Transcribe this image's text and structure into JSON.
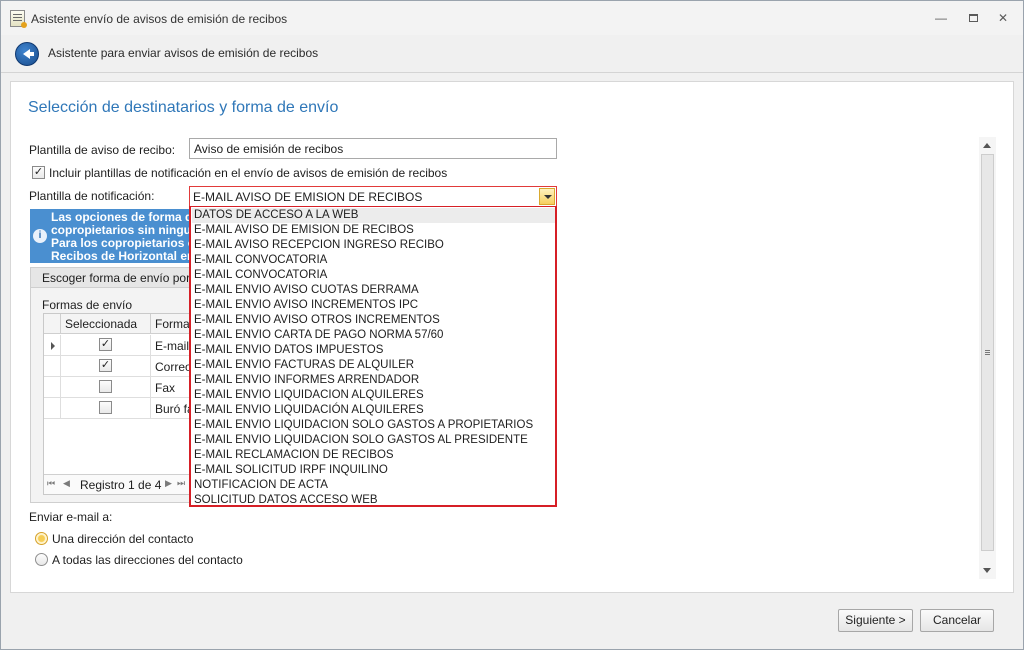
{
  "window": {
    "title": "Asistente envío de avisos de emisión de recibos",
    "minimize_glyph": "—",
    "close_glyph": "✕"
  },
  "header": {
    "title": "Asistente para enviar avisos de emisión de recibos"
  },
  "section": {
    "title": "Selección de destinatarios y forma de envío"
  },
  "form": {
    "plantilla_aviso_label": "Plantilla de aviso de recibo:",
    "plantilla_aviso_value": "Aviso de emisión de recibos",
    "incluir_checkbox_label": "Incluir plantillas de notificación en el envío de avisos de emisión de recibos",
    "incluir_checked": true,
    "plantilla_notificacion_label": "Plantilla de notificación:",
    "plantilla_notificacion_value": "E-MAIL AVISO DE EMISION DE RECIBOS"
  },
  "info": {
    "icon": "i",
    "lines": [
      "Las opciones de forma d",
      "copropietarios sin ningu",
      "Para los copropietarios c",
      "Recibos de Horizontal en"
    ]
  },
  "group": {
    "header": "Escoger forma de envío por de",
    "formas_label": "Formas de envío",
    "columns": [
      "Seleccionada",
      "Forma d"
    ],
    "rows": [
      {
        "selected": true,
        "name": "E-mail"
      },
      {
        "selected": true,
        "name": "Correo"
      },
      {
        "selected": false,
        "name": "Fax"
      },
      {
        "selected": false,
        "name": "Buró fax"
      }
    ],
    "navigator": {
      "first": "⏮",
      "prev": "◀",
      "record_text": "Registro 1 de 4",
      "next": "▶",
      "last": "⏭"
    }
  },
  "dropdown": {
    "items": [
      "DATOS DE ACCESO A LA WEB",
      "E-MAIL AVISO DE EMISION DE RECIBOS",
      "E-MAIL AVISO RECEPCION INGRESO RECIBO",
      "E-MAIL CONVOCATORIA",
      "E-MAIL CONVOCATORIA",
      "E-MAIL ENVIO AVISO CUOTAS DERRAMA",
      "E-MAIL ENVIO AVISO INCREMENTOS IPC",
      "E-MAIL ENVIO AVISO OTROS INCREMENTOS",
      "E-MAIL ENVIO CARTA DE PAGO NORMA 57/60",
      "E-MAIL ENVIO DATOS IMPUESTOS",
      "E-MAIL ENVIO FACTURAS DE ALQUILER",
      "E-MAIL ENVIO INFORMES ARRENDADOR",
      "E-MAIL ENVIO LIQUIDACION ALQUILERES",
      "E-MAIL ENVIO LIQUIDACIÓN ALQUILERES",
      "E-MAIL ENVIO LIQUIDACION SOLO GASTOS A PROPIETARIOS",
      "E-MAIL ENVIO LIQUIDACION SOLO GASTOS AL PRESIDENTE",
      "E-MAIL RECLAMACION DE RECIBOS",
      "E-MAIL SOLICITUD IRPF INQUILINO",
      "NOTIFICACION DE ACTA",
      "SOLICITUD DATOS ACCESO WEB"
    ],
    "highlighted_index": 0
  },
  "email": {
    "label": "Enviar e-mail a:",
    "options": [
      {
        "label": "Una dirección del contacto",
        "selected": true
      },
      {
        "label": "A todas las direcciones del contacto",
        "selected": false
      }
    ]
  },
  "buttons": {
    "next": "Siguiente >",
    "cancel": "Cancelar"
  },
  "colors": {
    "accent_title": "#2f77b8",
    "dropdown_border": "#d61f26",
    "info_banner": "#4a8fd0"
  }
}
